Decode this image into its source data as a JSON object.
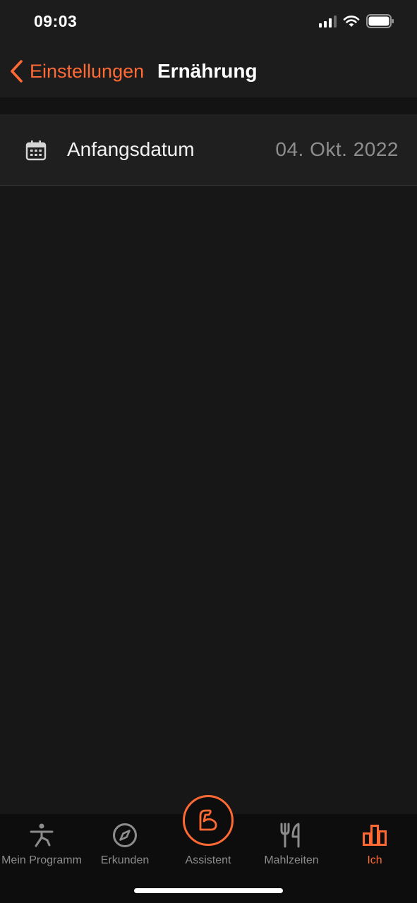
{
  "status_bar": {
    "time": "09:03"
  },
  "nav": {
    "back_label": "Einstellungen",
    "title": "Ernährung"
  },
  "settings": {
    "start_date": {
      "icon": "calendar-icon",
      "label": "Anfangsdatum",
      "value": "04. Okt. 2022"
    }
  },
  "tab_bar": {
    "items": [
      {
        "label": "Mein Programm",
        "icon": "exercise-person-icon",
        "active": false
      },
      {
        "label": "Erkunden",
        "icon": "compass-icon",
        "active": false
      },
      {
        "label": "Assistent",
        "icon": "flexed-arm-icon",
        "active": false
      },
      {
        "label": "Mahlzeiten",
        "icon": "fork-knife-icon",
        "active": false
      },
      {
        "label": "Ich",
        "icon": "bar-chart-icon",
        "active": true
      }
    ]
  },
  "colors": {
    "accent": "#ff6a34",
    "background": "#171717",
    "row_background": "#1f1f1f",
    "muted_text": "#8e8e8e"
  }
}
